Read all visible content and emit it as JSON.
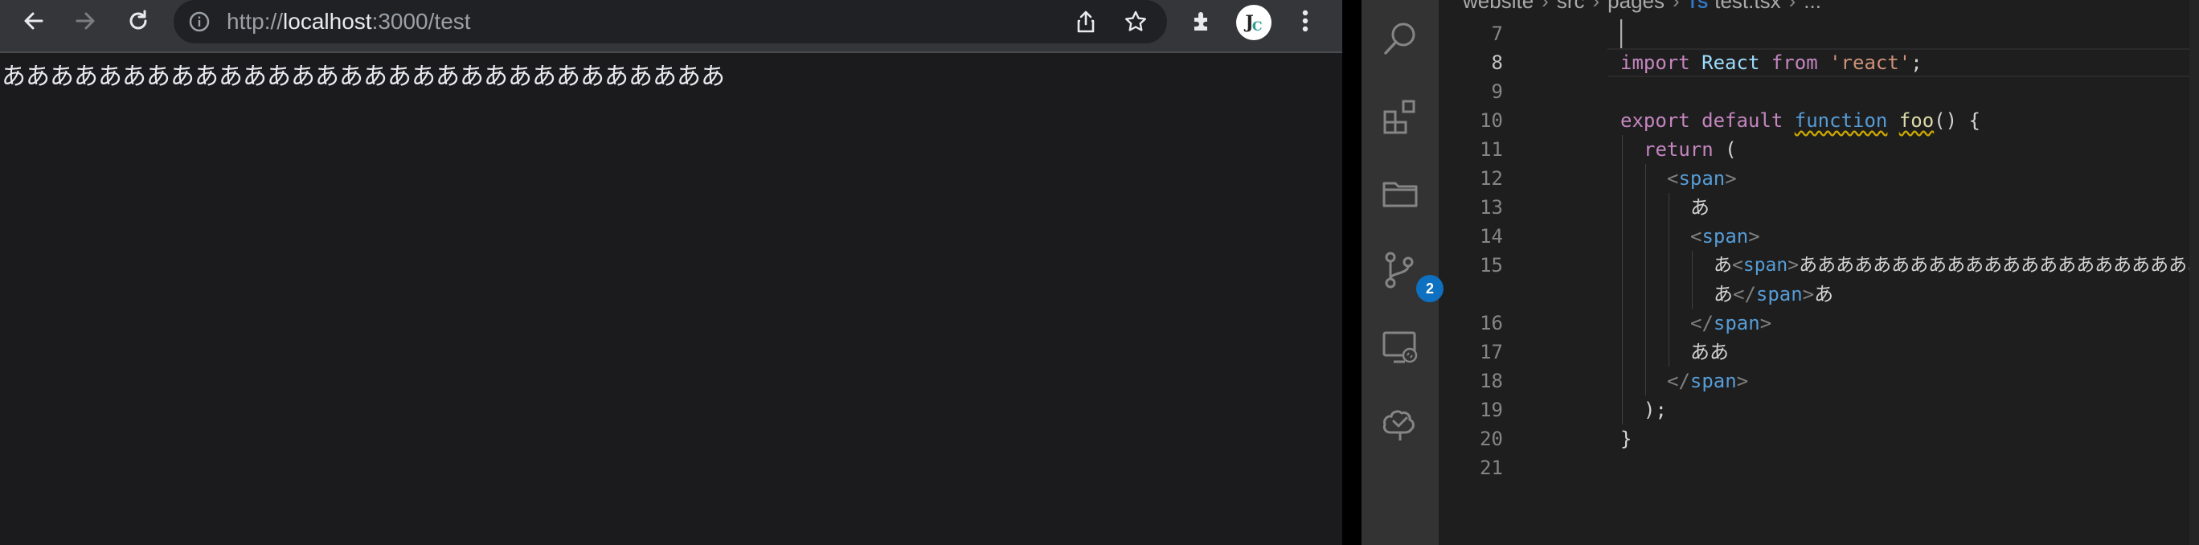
{
  "browser": {
    "url_scheme": "http://",
    "url_host": "localhost",
    "url_rest": ":3000/test",
    "page_text": "ああああああああああああああああああああああああああああああ",
    "icons": [
      "back-arrow-icon",
      "forward-arrow-icon",
      "reload-icon",
      "info-icon",
      "share-icon",
      "star-icon",
      "extensions-icon",
      "profile-avatar",
      "kebab-menu-icon"
    ]
  },
  "vscode": {
    "breadcrumb": {
      "parts": [
        "website",
        "src",
        "pages"
      ],
      "file_icon": "TS",
      "file": "test.tsx",
      "ellipsis": "..."
    },
    "source_control_badge": "2",
    "lines": [
      {
        "num": "7"
      },
      {
        "num": "8"
      },
      {
        "num": "9"
      },
      {
        "num": "10"
      },
      {
        "num": "11"
      },
      {
        "num": "12"
      },
      {
        "num": "13"
      },
      {
        "num": "14"
      },
      {
        "num": "15"
      },
      {
        "num": ""
      },
      {
        "num": "16"
      },
      {
        "num": "17"
      },
      {
        "num": "18"
      },
      {
        "num": "19"
      },
      {
        "num": "20"
      },
      {
        "num": "21"
      }
    ],
    "tokens": {
      "import": "import",
      "react_id": "React",
      "from": "from",
      "react_str": "'react'",
      "semi": ";",
      "export": "export",
      "default": "default",
      "function": "function",
      "foo": "foo",
      "foo_rest": "() {",
      "return": "return",
      "return_paren": " (",
      "lt": "<",
      "gt": ">",
      "lt_slash": "</",
      "span": "span",
      "a1": "あ",
      "a_line15_start": "あ",
      "a_line15_long": "ああああああああああああああああああああああああああ",
      "a_wrap_start": "あ",
      "a_wrap_end": "あ",
      "aa": "ああ",
      "close_paren": ");",
      "close_brace": "}"
    }
  }
}
